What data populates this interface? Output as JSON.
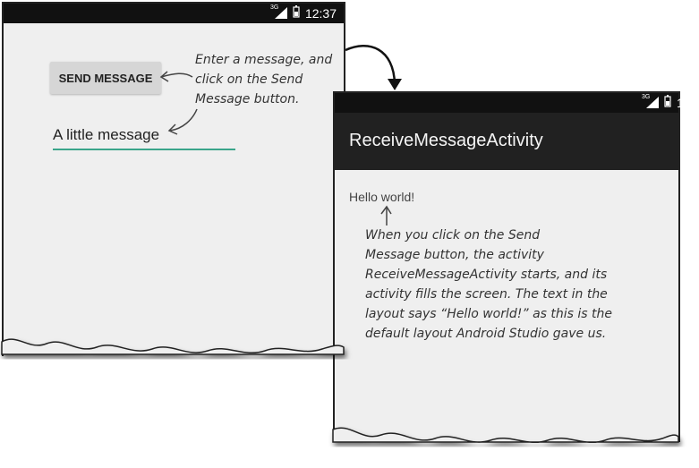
{
  "left_screen": {
    "status_time": "12:37",
    "network": "3G",
    "send_button_label": "SEND MESSAGE",
    "message_field_value": "A little message",
    "accent_color": "#3aa58a"
  },
  "right_screen": {
    "network": "3G",
    "app_title": "ReceiveMessageActivity",
    "body_text": "Hello world!"
  },
  "annotations": {
    "send_instruction": "Enter a message, and\nclick on the Send\nMessage button.",
    "receive_explanation": "When you click on the Send\nMessage button, the activity\nReceiveMessageActivity starts, and its\nactivity fills the screen. The text in the\nlayout says “Hello world!” as this is the\ndefault layout Android Studio gave us."
  }
}
